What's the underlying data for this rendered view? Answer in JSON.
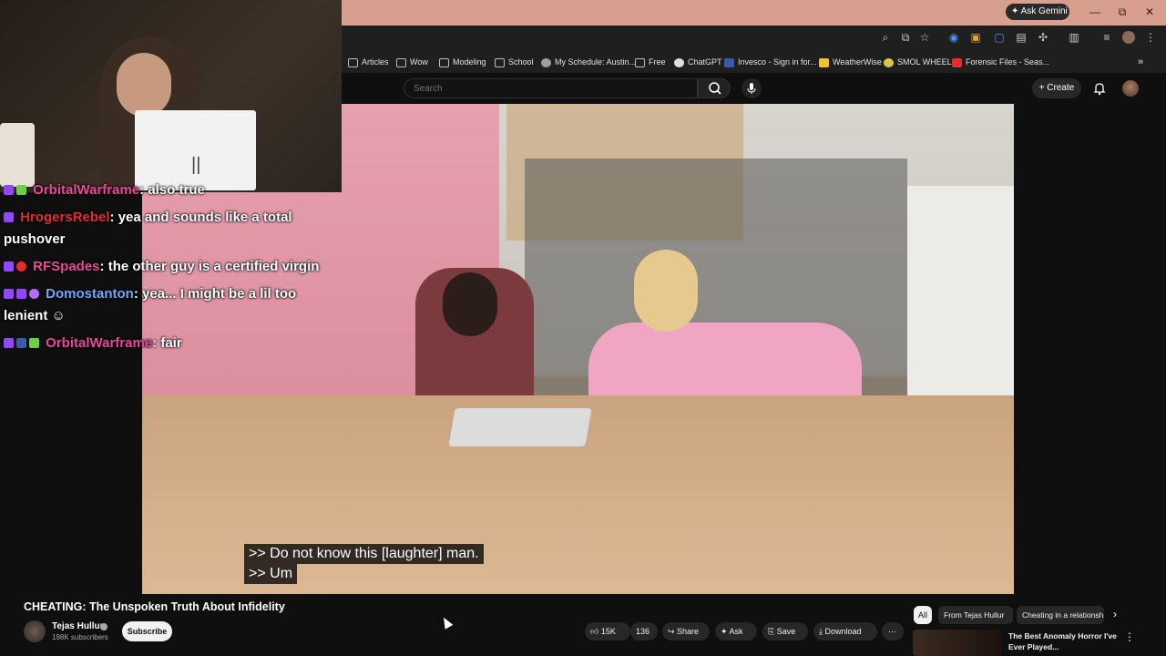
{
  "browser": {
    "gemini_label": "Ask Gemini",
    "window_controls": [
      "—",
      "⧉",
      "✕"
    ],
    "bookmarks": [
      {
        "label": "Articles",
        "icon": "folder-icon"
      },
      {
        "label": "Wow",
        "icon": "folder-icon"
      },
      {
        "label": "Modeling",
        "icon": "folder-icon"
      },
      {
        "label": "School",
        "icon": "folder-icon"
      },
      {
        "label": "My Schedule: Austin...",
        "icon": "globe-icon"
      },
      {
        "label": "Free",
        "icon": "folder-icon"
      },
      {
        "label": "ChatGPT",
        "icon": "chatgpt-icon"
      },
      {
        "label": "Invesco - Sign in for...",
        "icon": "invesco-icon"
      },
      {
        "label": "WeatherWise",
        "icon": "weather-icon"
      },
      {
        "label": "SMOL WHEEL",
        "icon": "wheel-icon"
      },
      {
        "label": "Forensic Files - Seas...",
        "icon": "youtube-icon"
      }
    ]
  },
  "youtube": {
    "search_placeholder": "Search",
    "create_label": "Create",
    "video": {
      "captions": [
        ">> Do not know this [laughter] man.",
        ">> Um"
      ],
      "title": "CHEATING: The Unspoken Truth About Infidelity",
      "channel": "Tejas Hullur",
      "subscribers": "198K subscribers",
      "subscribe_label": "Subscribe",
      "likes": "15K",
      "dislikes": "136",
      "share_label": "Share",
      "ask_label": "Ask",
      "save_label": "Save",
      "download_label": "Download"
    },
    "chips": [
      "All",
      "From Tejas Hullur",
      "Cheating in a relationsh"
    ],
    "recommendation": {
      "title": "The Best Anomaly Horror I've Ever Played..."
    }
  },
  "chat": {
    "messages": [
      {
        "user": "OrbitalWarframe",
        "text": ": also true",
        "user_color": "#e8479a"
      },
      {
        "user": "HrogersRebel",
        "text": ": yea and sounds like a total pushover",
        "user_color": "#e52b2b"
      },
      {
        "user": "RFSpades",
        "text": ": the other guy is a certified virgin",
        "user_color": "#e8479a"
      },
      {
        "user": "Domostanton",
        "text": ": yea... I might be a lil too lenient",
        "user_color": "#6fa8ff"
      },
      {
        "user": "OrbitalWarframe",
        "text": ": fair",
        "user_color": "#e8479a"
      }
    ]
  },
  "webcam": {
    "paper_mark": "||"
  }
}
